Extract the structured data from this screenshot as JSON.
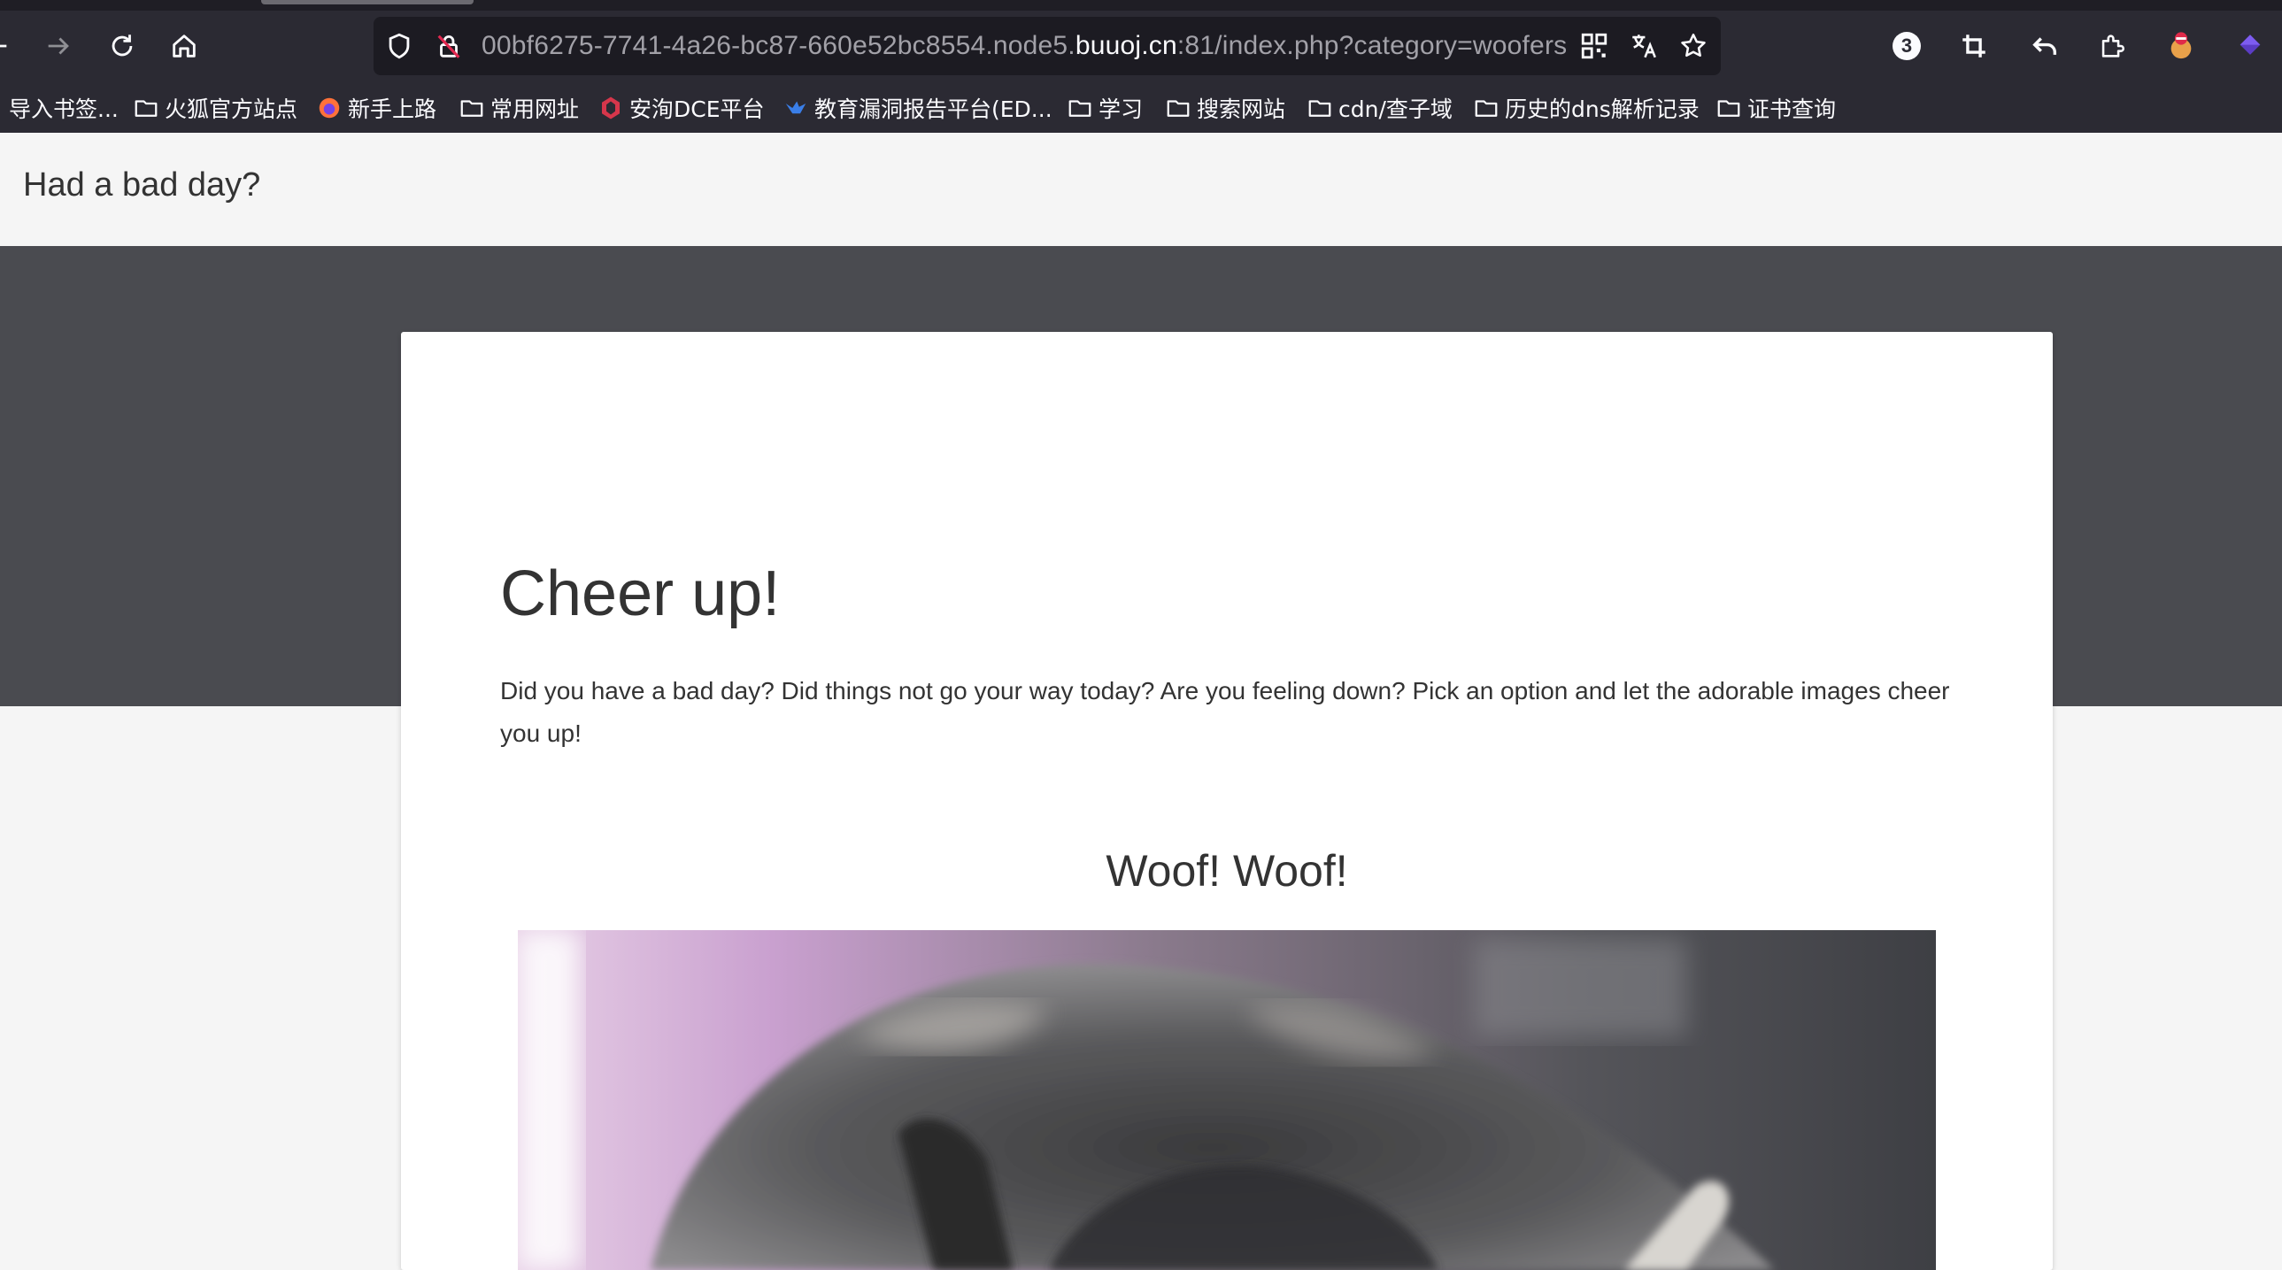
{
  "browser": {
    "url": {
      "pre_host": "00bf6275-7741-4a26-bc87-660e52bc8554.node5.",
      "host": "buuoj.cn",
      "post_host": ":81/index.php?category=woofers"
    },
    "extension_badge": "3",
    "bookmarks": [
      {
        "label": "导入书签...",
        "icon": "none"
      },
      {
        "label": "火狐官方站点",
        "icon": "folder-icon"
      },
      {
        "label": "新手上路",
        "icon": "firefox-icon"
      },
      {
        "label": "常用网址",
        "icon": "folder-icon"
      },
      {
        "label": "安洵DCE平台",
        "icon": "shield-logo-icon"
      },
      {
        "label": "教育漏洞报告平台(ED...",
        "icon": "bird-logo-icon"
      },
      {
        "label": "学习",
        "icon": "folder-icon"
      },
      {
        "label": "搜索网站",
        "icon": "folder-icon"
      },
      {
        "label": "cdn/查子域",
        "icon": "folder-icon"
      },
      {
        "label": "历史的dns解析记录",
        "icon": "folder-icon"
      },
      {
        "label": "证书查询",
        "icon": "folder-icon"
      }
    ]
  },
  "site": {
    "brand": "Had a bad day?",
    "card": {
      "title": "Cheer up!",
      "text": "Did you have a bad day? Did things not go your way today? Are you feeling down? Pick an option and let the adorable images cheer you up!",
      "section_title": "Woof! Woof!"
    }
  },
  "colors": {
    "chrome_bg": "#2b2a33",
    "urlbar_bg": "#1c1b22",
    "header_bg": "#f5f5f5",
    "hero_bg": "#4a4b50",
    "card_bg": "#ffffff",
    "text": "#333333"
  }
}
